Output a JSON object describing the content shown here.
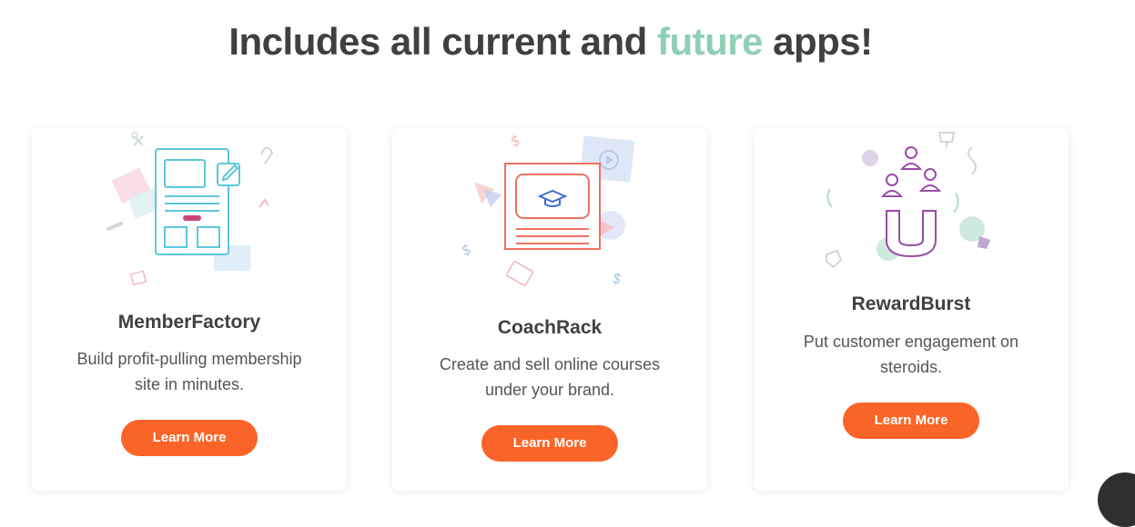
{
  "heading": {
    "part1": "Includes all current and ",
    "accent": "future",
    "part2": " apps!"
  },
  "cards": [
    {
      "title": "MemberFactory",
      "desc": [
        "Build profit-pulling membership",
        "site in minutes."
      ],
      "button": "Learn More"
    },
    {
      "title": "CoachRack",
      "desc": [
        "Create and sell online courses",
        "under your brand."
      ],
      "button": "Learn More"
    },
    {
      "title": "RewardBurst",
      "desc": [
        "Put customer engagement on",
        "steroids."
      ],
      "button": "Learn More"
    }
  ],
  "colors": {
    "accent": "#8fcfb5",
    "button": "#fb6428",
    "heading": "#404040"
  }
}
